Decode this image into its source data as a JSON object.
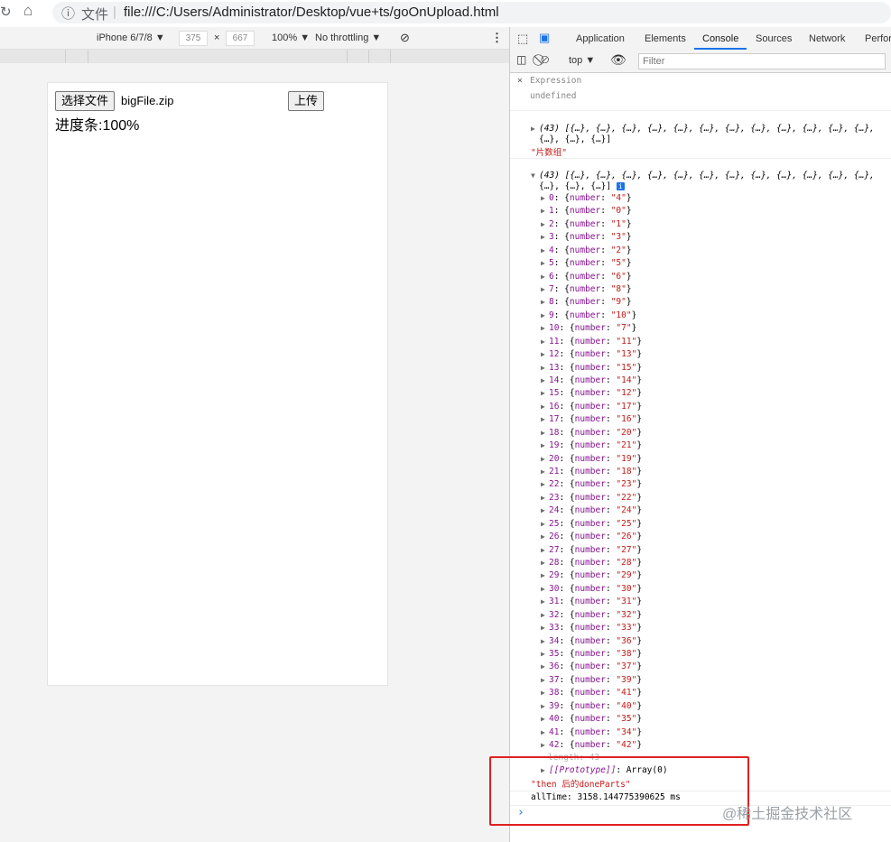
{
  "browser": {
    "security_label": "文件",
    "url": "file:///C:/Users/Administrator/Desktop/vue+ts/goOnUpload.html"
  },
  "device_toolbar": {
    "device": "iPhone 6/7/8 ▼",
    "width": "375",
    "times": "×",
    "height": "667",
    "zoom": "100% ▼",
    "throttling": "No throttling ▼"
  },
  "page": {
    "choose_file_button": "选择文件",
    "file_name": "bigFile.zip",
    "upload_button": "上传",
    "progress_text": "进度条:100%"
  },
  "devtools": {
    "tabs": [
      "Application",
      "Elements",
      "Console",
      "Sources",
      "Network",
      "Perfor"
    ],
    "active_tab": "Console",
    "context": "top ▼",
    "filter_placeholder": "Filter",
    "expression_label": "Expression",
    "expression_value": "undefined",
    "log1_line1": "(43) [{…}, {…}, {…}, {…}, {…}, {…}, {…}, {…}, {…}, {…}, {…}, {…},",
    "log1_line2": "{…}, {…}, {…}]",
    "log1_label": "\"片数组\"",
    "log2_line1": "(43) [{…}, {…}, {…}, {…}, {…}, {…}, {…}, {…}, {…}, {…}, {…}, {…},",
    "log2_line2": "{…}, {…}, {…}]",
    "items": [
      {
        "index": "0",
        "number": "4"
      },
      {
        "index": "1",
        "number": "0"
      },
      {
        "index": "2",
        "number": "1"
      },
      {
        "index": "3",
        "number": "3"
      },
      {
        "index": "4",
        "number": "2"
      },
      {
        "index": "5",
        "number": "5"
      },
      {
        "index": "6",
        "number": "6"
      },
      {
        "index": "7",
        "number": "8"
      },
      {
        "index": "8",
        "number": "9"
      },
      {
        "index": "9",
        "number": "10"
      },
      {
        "index": "10",
        "number": "7"
      },
      {
        "index": "11",
        "number": "11"
      },
      {
        "index": "12",
        "number": "13"
      },
      {
        "index": "13",
        "number": "15"
      },
      {
        "index": "14",
        "number": "14"
      },
      {
        "index": "15",
        "number": "12"
      },
      {
        "index": "16",
        "number": "17"
      },
      {
        "index": "17",
        "number": "16"
      },
      {
        "index": "18",
        "number": "20"
      },
      {
        "index": "19",
        "number": "21"
      },
      {
        "index": "20",
        "number": "19"
      },
      {
        "index": "21",
        "number": "18"
      },
      {
        "index": "22",
        "number": "23"
      },
      {
        "index": "23",
        "number": "22"
      },
      {
        "index": "24",
        "number": "24"
      },
      {
        "index": "25",
        "number": "25"
      },
      {
        "index": "26",
        "number": "26"
      },
      {
        "index": "27",
        "number": "27"
      },
      {
        "index": "28",
        "number": "28"
      },
      {
        "index": "29",
        "number": "29"
      },
      {
        "index": "30",
        "number": "30"
      },
      {
        "index": "31",
        "number": "31"
      },
      {
        "index": "32",
        "number": "32"
      },
      {
        "index": "33",
        "number": "33"
      },
      {
        "index": "34",
        "number": "36"
      },
      {
        "index": "35",
        "number": "38"
      },
      {
        "index": "36",
        "number": "37"
      },
      {
        "index": "37",
        "number": "39"
      },
      {
        "index": "38",
        "number": "41"
      },
      {
        "index": "39",
        "number": "40"
      },
      {
        "index": "40",
        "number": "35"
      },
      {
        "index": "41",
        "number": "34"
      },
      {
        "index": "42",
        "number": "42"
      }
    ],
    "length_line": "length: 43",
    "prototype_key": "[[Prototype]]",
    "prototype_value": ": Array(0)",
    "then_label": "\"then 后的doneParts\"",
    "alltime": "allTime: 3158.144775390625 ms",
    "prompt": "›"
  },
  "watermark": "@稀土掘金技术社区",
  "colors": {
    "highlight_box": "#e02020",
    "active_tab_underline": "#1a73e8",
    "property_key": "#881391",
    "string_value": "#c41a16"
  }
}
